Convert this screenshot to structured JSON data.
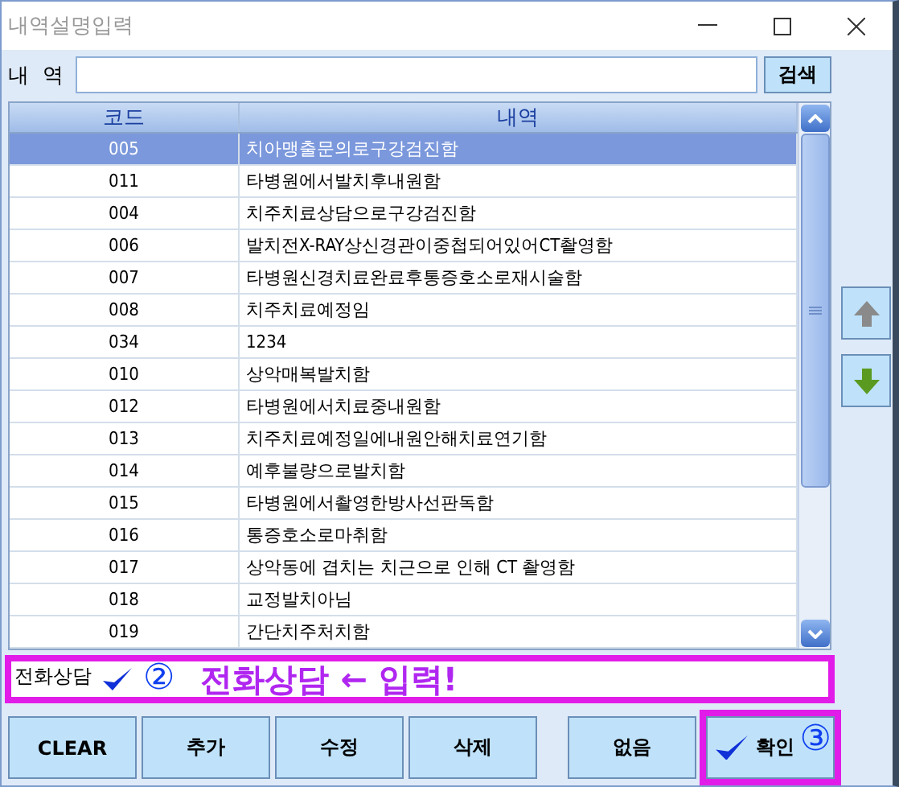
{
  "window": {
    "title": "내역설명입력"
  },
  "search": {
    "label": "내  역",
    "button": "검색"
  },
  "table": {
    "columns": [
      "코드",
      "내역"
    ],
    "rows": [
      {
        "code": "005",
        "description": "치아맹출문의로구강검진함",
        "selected": true
      },
      {
        "code": "011",
        "description": "타병원에서발치후내원함",
        "selected": false
      },
      {
        "code": "004",
        "description": "치주치료상담으로구강검진함",
        "selected": false
      },
      {
        "code": "006",
        "description": "발치전X-RAY상신경관이중첩되어있어CT촬영함",
        "selected": false
      },
      {
        "code": "007",
        "description": "타병원신경치료완료후통증호소로재시술함",
        "selected": false
      },
      {
        "code": "008",
        "description": "치주치료예정임",
        "selected": false
      },
      {
        "code": "034",
        "description": "1234",
        "selected": false
      },
      {
        "code": "010",
        "description": "상악매복발치함",
        "selected": false
      },
      {
        "code": "012",
        "description": "타병원에서치료중내원함",
        "selected": false
      },
      {
        "code": "013",
        "description": "치주치료예정일에내원안해치료연기함",
        "selected": false
      },
      {
        "code": "014",
        "description": "예후불량으로발치함",
        "selected": false
      },
      {
        "code": "015",
        "description": "타병원에서촬영한방사선판독함",
        "selected": false
      },
      {
        "code": "016",
        "description": "통증호소로마취함",
        "selected": false
      },
      {
        "code": "017",
        "description": "상악동에 겹치는 치근으로 인해 CT 촬영함",
        "selected": false
      },
      {
        "code": "018",
        "description": "교정발치아님",
        "selected": false
      },
      {
        "code": "019",
        "description": "간단치주처치함",
        "selected": false
      }
    ]
  },
  "memo": {
    "value": "전화상담",
    "marker": "②",
    "note": "전화상담 ← 입력!"
  },
  "buttons": [
    {
      "label": "CLEAR",
      "kind": "plain"
    },
    {
      "label": "추가",
      "kind": "plain"
    },
    {
      "label": "수정",
      "kind": "plain"
    },
    {
      "label": "삭제",
      "kind": "plain"
    },
    {
      "label": "없음",
      "kind": "spaced"
    },
    {
      "label": "확인",
      "kind": "confirm",
      "marker": "③"
    }
  ]
}
